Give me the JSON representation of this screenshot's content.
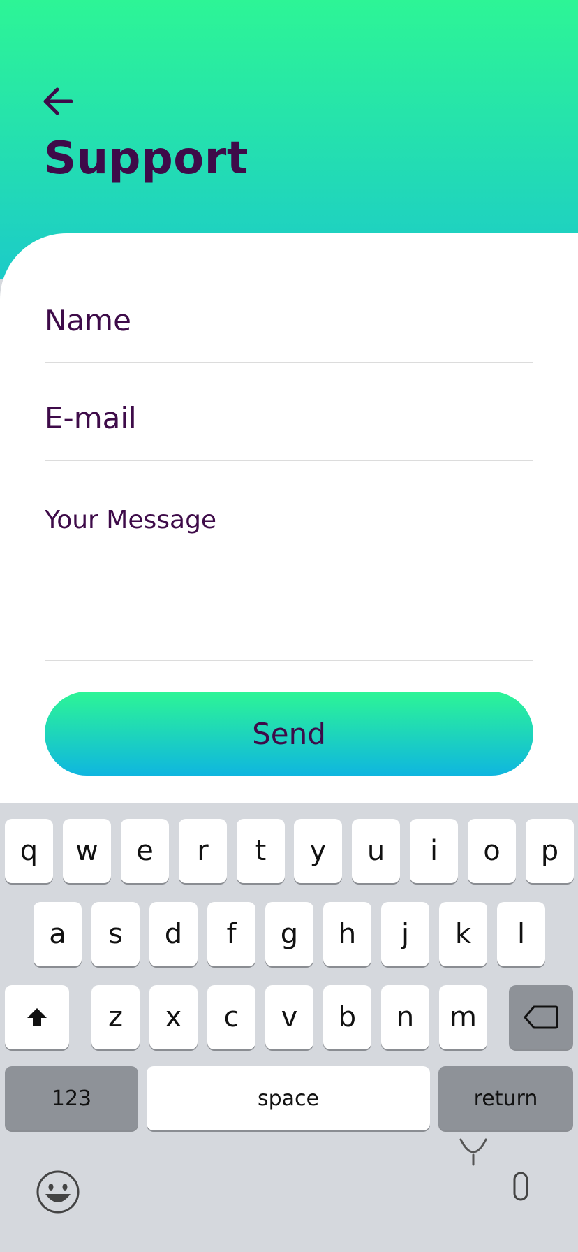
{
  "header": {
    "title": "Support"
  },
  "form": {
    "name_placeholder": "Name",
    "email_placeholder": "E-mail",
    "message_placeholder": "Your Message",
    "send_label": "Send"
  },
  "keyboard": {
    "row1": [
      "q",
      "w",
      "e",
      "r",
      "t",
      "y",
      "u",
      "i",
      "o",
      "p"
    ],
    "row2": [
      "a",
      "s",
      "d",
      "f",
      "g",
      "h",
      "j",
      "k",
      "l"
    ],
    "row3": [
      "z",
      "x",
      "c",
      "v",
      "b",
      "n",
      "m"
    ],
    "numbers_label": "123",
    "space_label": "space",
    "return_label": "return"
  },
  "icons": [
    "back-arrow-icon",
    "shift-icon",
    "backspace-icon",
    "emoji-icon",
    "microphone-icon"
  ],
  "colors": {
    "accent_top": "#2df596",
    "accent_bottom": "#1ccbc8",
    "text": "#3e0b49"
  }
}
